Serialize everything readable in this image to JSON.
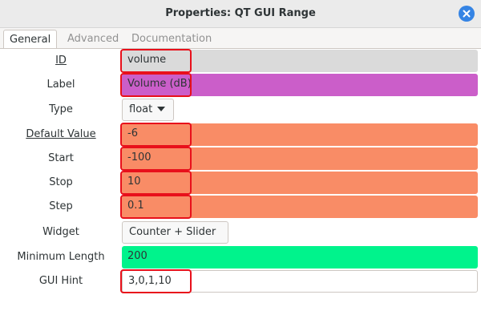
{
  "window": {
    "title": "Properties: QT GUI Range",
    "close_icon": "close-icon"
  },
  "tabs": [
    {
      "label": "General",
      "active": true
    },
    {
      "label": "Advanced",
      "active": false
    },
    {
      "label": "Documentation",
      "active": false
    }
  ],
  "fields": {
    "id": {
      "label": "ID",
      "value": "volume"
    },
    "label": {
      "label": "Label",
      "value": "Volume (dB)"
    },
    "type": {
      "label": "Type",
      "value": "float"
    },
    "default_value": {
      "label": "Default Value",
      "value": "-6"
    },
    "start": {
      "label": "Start",
      "value": "-100"
    },
    "stop": {
      "label": "Stop",
      "value": "10"
    },
    "step": {
      "label": "Step",
      "value": "0.1"
    },
    "widget": {
      "label": "Widget",
      "value": "Counter + Slider"
    },
    "minimum_length": {
      "label": "Minimum Length",
      "value": "200"
    },
    "gui_hint": {
      "label": "GUI Hint",
      "value": "3,0,1,10"
    }
  },
  "colors": {
    "id_bg": "#dadada",
    "label_bg": "#cb5ec9",
    "float_bg": "#f98c66",
    "int_bg": "#00f38c",
    "highlight": "#e8101b",
    "accent": "#3584e4"
  }
}
